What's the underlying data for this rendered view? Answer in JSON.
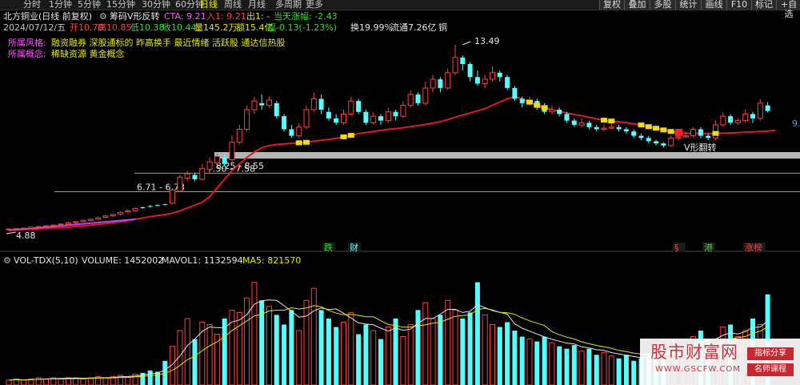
{
  "toolbar": {
    "periods": [
      "分时",
      "1分钟",
      "5分钟",
      "15分钟",
      "30分钟",
      "60分钟",
      "日线",
      "周线",
      "月线",
      "多周期",
      "更多"
    ],
    "active_period": "日线",
    "buttons": [
      "复权",
      "叠加",
      "多股",
      "统计",
      "画线",
      "F10",
      "标记",
      "+自选"
    ]
  },
  "header": {
    "stock": "北方铜业(日线 前复权)",
    "indicator": "筹码V形反转",
    "cta": "CTA: 9.21",
    "entry": "入1: 9.21",
    "exit": "出1: -",
    "day_change": "当天涨幅: -2.43"
  },
  "info": {
    "date": "2024/07/12/五",
    "open": "开10.70",
    "high": "高10.85",
    "low": "低10.38",
    "close": "收10.44",
    "volume": "量145.2万",
    "amount": "额15.4亿",
    "amplitude": "幅-0.13(-1.23%)",
    "turnover": "换19.99%",
    "float_cap": "流通7.26亿",
    "sector": "铜"
  },
  "tags": {
    "style_label": "所属风格:",
    "style_value": "融资融券 深股通标的 昨高换手 最近情绪 活跃股 通达信热股",
    "concept_label": "所属概念:",
    "concept_value": "稀缺资源 黄金概念"
  },
  "annotations": {
    "high_label": "13.49",
    "low_label": "4.88",
    "zone1": "8.25 - 8.55",
    "zone2": "7.50 - 7.58",
    "zone3": "6.71 - 6.73",
    "v_reversal": "V形翻转",
    "right_edge_price": "9.",
    "markers": [
      "跌",
      "财",
      "§",
      "港",
      "涨榜"
    ]
  },
  "volume_header": {
    "name": "VOL-TDX(5,10)",
    "volume": "VOLUME: 1452002",
    "mavol1": "MAVOL1: 1132594",
    "ma5": "MA5: 821570"
  },
  "watermark": {
    "title": "股市财富网",
    "url": "WWW.GSCFW.COM",
    "tag1": "指标分享",
    "tag2": "名师课程"
  },
  "colors": {
    "up": "#ff4040",
    "down": "#54ffff",
    "ma_line": "#e0182a",
    "zone_fill": "#c8c8c8",
    "background": "#000000"
  },
  "chart_data": {
    "type": "candlestick",
    "price_range": [
      4.5,
      14.0
    ],
    "candles": [
      {
        "o": 4.98,
        "c": 5.01,
        "h": 5.04,
        "l": 4.95
      },
      {
        "o": 5.01,
        "c": 5.03,
        "h": 5.06,
        "l": 4.98
      },
      {
        "o": 5.03,
        "c": 5.05,
        "h": 5.08,
        "l": 5.0
      },
      {
        "o": 5.04,
        "c": 5.1,
        "h": 5.13,
        "l": 5.02
      },
      {
        "o": 5.1,
        "c": 5.12,
        "h": 5.16,
        "l": 5.07
      },
      {
        "o": 5.12,
        "c": 5.16,
        "h": 5.19,
        "l": 5.09
      },
      {
        "o": 5.15,
        "c": 5.19,
        "h": 5.22,
        "l": 5.12
      },
      {
        "o": 5.2,
        "c": 5.24,
        "h": 5.27,
        "l": 5.17
      },
      {
        "o": 5.23,
        "c": 5.29,
        "h": 5.33,
        "l": 5.2
      },
      {
        "o": 5.3,
        "c": 5.35,
        "h": 5.38,
        "l": 5.26
      },
      {
        "o": 5.35,
        "c": 5.41,
        "h": 5.45,
        "l": 5.31
      },
      {
        "o": 5.4,
        "c": 5.46,
        "h": 5.5,
        "l": 5.36
      },
      {
        "o": 5.47,
        "c": 5.53,
        "h": 5.58,
        "l": 5.43
      },
      {
        "o": 5.55,
        "c": 5.61,
        "h": 5.66,
        "l": 5.5
      },
      {
        "o": 5.62,
        "c": 5.68,
        "h": 5.72,
        "l": 5.57
      },
      {
        "o": 5.7,
        "c": 5.78,
        "h": 5.83,
        "l": 5.64
      },
      {
        "o": 5.8,
        "c": 5.85,
        "h": 5.92,
        "l": 5.74
      },
      {
        "o": 5.85,
        "c": 5.95,
        "h": 6.0,
        "l": 5.8
      },
      {
        "o": 6.01,
        "c": 5.99,
        "h": 6.05,
        "l": 5.95
      },
      {
        "o": 6.07,
        "c": 6.05,
        "h": 6.11,
        "l": 6.0
      },
      {
        "o": 6.11,
        "c": 6.1,
        "h": 6.15,
        "l": 6.05
      },
      {
        "o": 6.15,
        "c": 6.13,
        "h": 6.18,
        "l": 6.1
      },
      {
        "o": 6.2,
        "c": 6.8,
        "h": 6.9,
        "l": 6.15
      },
      {
        "o": 6.75,
        "c": 7.4,
        "h": 7.5,
        "l": 6.7
      },
      {
        "o": 7.35,
        "c": 7.55,
        "h": 7.7,
        "l": 7.2
      },
      {
        "o": 7.5,
        "c": 7.3,
        "h": 7.6,
        "l": 7.2
      },
      {
        "o": 7.3,
        "c": 7.8,
        "h": 8.0,
        "l": 7.25
      },
      {
        "o": 7.75,
        "c": 8.1,
        "h": 8.3,
        "l": 7.6
      },
      {
        "o": 8.05,
        "c": 8.35,
        "h": 8.5,
        "l": 8.0
      },
      {
        "o": 8.3,
        "c": 8.0,
        "h": 8.45,
        "l": 7.9
      },
      {
        "o": 8.2,
        "c": 9.0,
        "h": 9.3,
        "l": 8.1
      },
      {
        "o": 9.0,
        "c": 9.6,
        "h": 9.8,
        "l": 8.9
      },
      {
        "o": 9.6,
        "c": 10.5,
        "h": 10.7,
        "l": 9.5
      },
      {
        "o": 10.5,
        "c": 10.9,
        "h": 11.1,
        "l": 10.3
      },
      {
        "o": 10.8,
        "c": 10.7,
        "h": 11.2,
        "l": 10.5
      },
      {
        "o": 10.7,
        "c": 10.95,
        "h": 11.1,
        "l": 10.6
      },
      {
        "o": 10.8,
        "c": 10.2,
        "h": 10.9,
        "l": 10.1
      },
      {
        "o": 10.2,
        "c": 9.6,
        "h": 10.3,
        "l": 9.5
      },
      {
        "o": 9.6,
        "c": 9.3,
        "h": 9.8,
        "l": 9.2
      },
      {
        "o": 9.3,
        "c": 9.7,
        "h": 9.9,
        "l": 9.2
      },
      {
        "o": 9.7,
        "c": 10.5,
        "h": 10.7,
        "l": 9.6
      },
      {
        "o": 10.5,
        "c": 11.0,
        "h": 11.3,
        "l": 10.4
      },
      {
        "o": 11.0,
        "c": 10.5,
        "h": 11.2,
        "l": 10.3
      },
      {
        "o": 10.4,
        "c": 10.1,
        "h": 10.6,
        "l": 10.0
      },
      {
        "o": 10.1,
        "c": 9.9,
        "h": 10.3,
        "l": 9.8
      },
      {
        "o": 9.9,
        "c": 10.3,
        "h": 10.5,
        "l": 9.8
      },
      {
        "o": 10.3,
        "c": 10.9,
        "h": 11.1,
        "l": 10.2
      },
      {
        "o": 10.9,
        "c": 10.4,
        "h": 11.0,
        "l": 10.3
      },
      {
        "o": 10.4,
        "c": 9.9,
        "h": 10.5,
        "l": 9.8
      },
      {
        "o": 9.9,
        "c": 10.2,
        "h": 10.4,
        "l": 9.8
      },
      {
        "o": 10.2,
        "c": 10.0,
        "h": 10.3,
        "l": 9.8
      },
      {
        "o": 10.0,
        "c": 10.4,
        "h": 10.6,
        "l": 9.9
      },
      {
        "o": 10.4,
        "c": 10.2,
        "h": 10.5,
        "l": 10.0
      },
      {
        "o": 10.2,
        "c": 10.7,
        "h": 10.9,
        "l": 10.1
      },
      {
        "o": 10.7,
        "c": 11.2,
        "h": 11.4,
        "l": 10.6
      },
      {
        "o": 11.2,
        "c": 10.8,
        "h": 11.3,
        "l": 10.7
      },
      {
        "o": 10.8,
        "c": 11.5,
        "h": 11.8,
        "l": 10.7
      },
      {
        "o": 11.5,
        "c": 11.9,
        "h": 12.1,
        "l": 11.3
      },
      {
        "o": 11.9,
        "c": 11.5,
        "h": 12.0,
        "l": 11.3
      },
      {
        "o": 11.5,
        "c": 12.2,
        "h": 12.4,
        "l": 11.4
      },
      {
        "o": 12.2,
        "c": 12.9,
        "h": 13.49,
        "l": 12.1
      },
      {
        "o": 12.9,
        "c": 12.6,
        "h": 13.0,
        "l": 12.3
      },
      {
        "o": 12.6,
        "c": 12.0,
        "h": 12.7,
        "l": 11.8
      },
      {
        "o": 12.0,
        "c": 11.7,
        "h": 12.3,
        "l": 11.6
      },
      {
        "o": 11.7,
        "c": 11.9,
        "h": 12.1,
        "l": 11.5
      },
      {
        "o": 11.9,
        "c": 12.2,
        "h": 12.5,
        "l": 11.8
      },
      {
        "o": 12.2,
        "c": 12.0,
        "h": 12.3,
        "l": 11.8
      },
      {
        "o": 12.0,
        "c": 11.5,
        "h": 12.1,
        "l": 11.4
      },
      {
        "o": 11.5,
        "c": 11.0,
        "h": 11.6,
        "l": 10.9
      },
      {
        "o": 11.0,
        "c": 10.8,
        "h": 11.1,
        "l": 10.6
      },
      {
        "o": 10.8,
        "c": 10.9,
        "h": 11.1,
        "l": 10.7
      },
      {
        "o": 10.9,
        "c": 10.6,
        "h": 11.0,
        "l": 10.5
      },
      {
        "o": 10.6,
        "c": 10.4,
        "h": 10.8,
        "l": 10.3
      },
      {
        "o": 10.4,
        "c": 10.5,
        "h": 10.7,
        "l": 10.3
      },
      {
        "o": 10.5,
        "c": 10.3,
        "h": 10.6,
        "l": 10.2
      },
      {
        "o": 10.3,
        "c": 10.0,
        "h": 10.4,
        "l": 9.9
      },
      {
        "o": 10.0,
        "c": 9.8,
        "h": 10.1,
        "l": 9.7
      },
      {
        "o": 9.8,
        "c": 9.9,
        "h": 10.1,
        "l": 9.7
      },
      {
        "o": 9.9,
        "c": 9.7,
        "h": 10.0,
        "l": 9.6
      },
      {
        "o": 9.7,
        "c": 9.6,
        "h": 9.8,
        "l": 9.5
      },
      {
        "o": 9.6,
        "c": 9.65,
        "h": 9.8,
        "l": 9.5
      },
      {
        "o": 9.65,
        "c": 9.7,
        "h": 9.9,
        "l": 9.6
      },
      {
        "o": 9.7,
        "c": 9.6,
        "h": 9.8,
        "l": 9.5
      },
      {
        "o": 9.6,
        "c": 9.5,
        "h": 9.7,
        "l": 9.4
      },
      {
        "o": 9.5,
        "c": 9.3,
        "h": 9.6,
        "l": 9.2
      },
      {
        "o": 9.3,
        "c": 9.2,
        "h": 9.4,
        "l": 9.1
      },
      {
        "o": 9.2,
        "c": 9.05,
        "h": 9.3,
        "l": 8.95
      },
      {
        "o": 9.05,
        "c": 8.95,
        "h": 9.1,
        "l": 8.85
      },
      {
        "o": 8.95,
        "c": 8.85,
        "h": 9.0,
        "l": 8.75
      },
      {
        "o": 8.85,
        "c": 9.2,
        "h": 9.3,
        "l": 8.8
      },
      {
        "o": 9.2,
        "c": 9.25,
        "h": 9.4,
        "l": 9.1
      },
      {
        "o": 9.25,
        "c": 9.3,
        "h": 9.5,
        "l": 9.2
      },
      {
        "o": 9.3,
        "c": 9.6,
        "h": 9.7,
        "l": 9.2
      },
      {
        "o": 9.6,
        "c": 9.3,
        "h": 9.7,
        "l": 9.2
      },
      {
        "o": 9.3,
        "c": 9.2,
        "h": 9.4,
        "l": 9.1
      },
      {
        "o": 9.2,
        "c": 9.8,
        "h": 10.0,
        "l": 9.1
      },
      {
        "o": 9.8,
        "c": 10.2,
        "h": 10.4,
        "l": 9.7
      },
      {
        "o": 10.2,
        "c": 9.9,
        "h": 10.3,
        "l": 9.8
      },
      {
        "o": 9.9,
        "c": 10.0,
        "h": 10.1,
        "l": 9.8
      },
      {
        "o": 10.0,
        "c": 10.3,
        "h": 10.5,
        "l": 9.9
      },
      {
        "o": 10.3,
        "c": 10.1,
        "h": 10.4,
        "l": 9.9
      },
      {
        "o": 10.1,
        "c": 10.8,
        "h": 11.0,
        "l": 10.0
      },
      {
        "o": 10.7,
        "c": 10.44,
        "h": 10.85,
        "l": 10.38
      }
    ],
    "ma_line": [
      4.95,
      4.97,
      4.99,
      5.0,
      5.02,
      5.04,
      5.06,
      5.08,
      5.1,
      5.13,
      5.16,
      5.19,
      5.22,
      5.26,
      5.3,
      5.35,
      5.4,
      5.46,
      5.52,
      5.58,
      5.63,
      5.68,
      5.74,
      5.85,
      5.98,
      6.1,
      6.25,
      6.5,
      6.9,
      7.3,
      7.7,
      8.0,
      8.3,
      8.55,
      8.75,
      8.85,
      8.9,
      8.93,
      8.95,
      8.98,
      9.0,
      9.05,
      9.1,
      9.13,
      9.18,
      9.25,
      9.32,
      9.4,
      9.45,
      9.5,
      9.55,
      9.6,
      9.63,
      9.67,
      9.72,
      9.77,
      9.82,
      9.88,
      9.95,
      10.05,
      10.15,
      10.25,
      10.35,
      10.45,
      10.55,
      10.7,
      10.85,
      11.0,
      11.1,
      11.0,
      10.85,
      10.7,
      10.6,
      10.5,
      10.42,
      10.35,
      10.28,
      10.22,
      10.15,
      10.08,
      10.02,
      9.98,
      9.94,
      9.9,
      9.85,
      9.8,
      9.72,
      9.65,
      9.57,
      9.5,
      9.45,
      9.42,
      9.41,
      9.4,
      9.4,
      9.41,
      9.42,
      9.43,
      9.45,
      9.46,
      9.48,
      9.5,
      9.52,
      9.55
    ],
    "volumes": [
      0.04,
      0.05,
      0.04,
      0.05,
      0.06,
      0.05,
      0.06,
      0.05,
      0.06,
      0.06,
      0.05,
      0.06,
      0.07,
      0.06,
      0.07,
      0.08,
      0.07,
      0.09,
      0.1,
      0.12,
      0.11,
      0.2,
      0.32,
      0.45,
      0.55,
      0.38,
      0.52,
      0.5,
      0.42,
      0.55,
      0.62,
      0.6,
      0.72,
      0.85,
      0.7,
      0.65,
      0.58,
      0.5,
      0.62,
      0.45,
      0.7,
      0.8,
      0.62,
      0.55,
      0.48,
      0.52,
      0.6,
      0.42,
      0.5,
      0.45,
      0.38,
      0.48,
      0.55,
      0.4,
      0.5,
      0.62,
      0.68,
      0.55,
      0.58,
      0.7,
      0.62,
      0.55,
      0.6,
      0.85,
      0.58,
      0.5,
      0.48,
      0.52,
      0.45,
      0.4,
      0.38,
      0.36,
      0.4,
      0.35,
      0.32,
      0.3,
      0.33,
      0.28,
      0.3,
      0.25,
      0.27,
      0.24,
      0.22,
      0.25,
      0.2,
      0.22,
      0.26,
      0.24,
      0.3,
      0.36,
      0.28,
      0.32,
      0.4,
      0.45,
      0.35,
      0.38,
      0.48,
      0.5,
      0.4,
      0.45,
      0.55,
      0.5,
      0.75
    ],
    "zones": [
      {
        "label": "8.25 - 8.55",
        "low": 8.25,
        "high": 8.55
      },
      {
        "label": "7.50 - 7.58",
        "low": 7.5,
        "high": 7.58
      },
      {
        "label": "6.71 - 6.73",
        "low": 6.71,
        "high": 6.73
      }
    ]
  }
}
